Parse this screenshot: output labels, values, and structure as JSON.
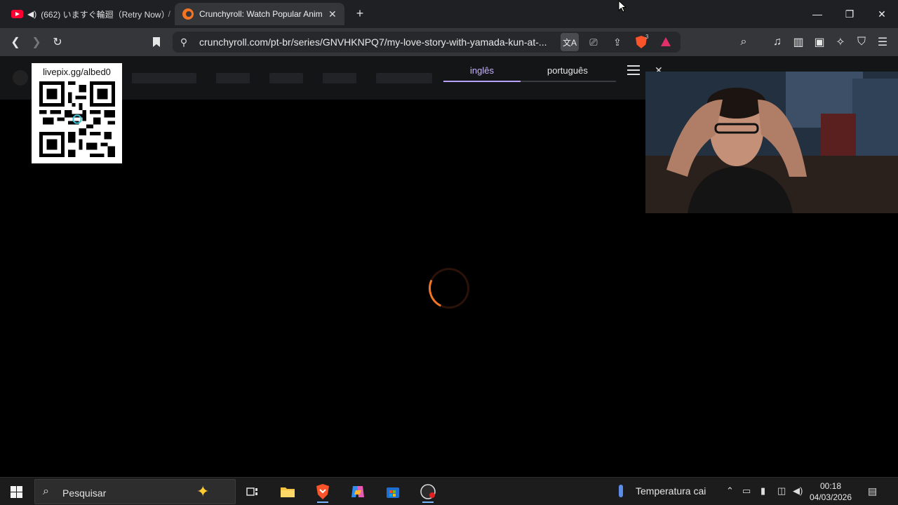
{
  "browser": {
    "tabs": [
      {
        "title": "(662) いますぐ輪廻（Retry Now）",
        "active": false,
        "audio": true
      },
      {
        "title": "Crunchyroll: Watch Popular Anim",
        "active": true
      }
    ],
    "url": "crunchyroll.com/pt-br/series/GNVHKNPQ7/my-love-story-with-yamada-kun-at-...",
    "shield_count": "3"
  },
  "overlay": {
    "qr_label": "livepix.gg/albed0"
  },
  "language_bar": {
    "tabs": [
      "inglês",
      "português"
    ],
    "active": "inglês"
  },
  "page": {
    "loading": true,
    "accent": "#f47521"
  },
  "taskbar": {
    "search_placeholder": "Pesquisar",
    "weather": "Temperatura cai",
    "time": "00:18",
    "date": "04/03/2026",
    "notification_count": "1"
  },
  "icons": {
    "youtube": "youtube-icon",
    "crunchyroll": "crunchyroll-icon",
    "brave": "brave-icon"
  }
}
